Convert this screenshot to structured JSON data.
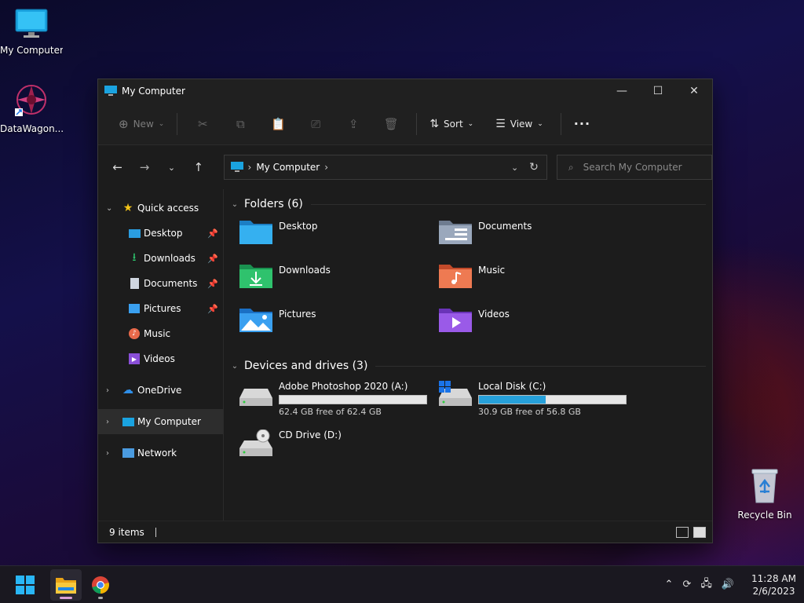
{
  "desktop": {
    "icons": [
      {
        "label": "My Computer"
      },
      {
        "label": "DataWagon..."
      },
      {
        "label": "Recycle Bin"
      }
    ]
  },
  "window": {
    "title": "My Computer",
    "controls": {
      "minimize": "—",
      "maximize": "☐",
      "close": "✕"
    }
  },
  "toolbar": {
    "new_label": "New",
    "sort_label": "Sort",
    "view_label": "View",
    "more_label": "···"
  },
  "nav": {
    "address_crumb": "My Computer",
    "search_placeholder": "Search My Computer"
  },
  "sidebar": {
    "items": [
      {
        "label": "Quick access"
      },
      {
        "label": "Desktop"
      },
      {
        "label": "Downloads"
      },
      {
        "label": "Documents"
      },
      {
        "label": "Pictures"
      },
      {
        "label": "Music"
      },
      {
        "label": "Videos"
      },
      {
        "label": "OneDrive"
      },
      {
        "label": "My Computer"
      },
      {
        "label": "Network"
      }
    ]
  },
  "content": {
    "folders_header": "Folders (6)",
    "folders": [
      {
        "label": "Desktop"
      },
      {
        "label": "Documents"
      },
      {
        "label": "Downloads"
      },
      {
        "label": "Music"
      },
      {
        "label": "Pictures"
      },
      {
        "label": "Videos"
      }
    ],
    "drives_header": "Devices and drives (3)",
    "drives": [
      {
        "name": "Adobe Photoshop 2020 (A:)",
        "free": "62.4 GB free of 62.4 GB",
        "used_fraction": 0.0
      },
      {
        "name": "Local Disk (C:)",
        "free": "30.9 GB free of 56.8 GB",
        "used_fraction": 0.456
      },
      {
        "name": "CD Drive (D:)"
      }
    ]
  },
  "status": {
    "items_count": "9 items"
  },
  "taskbar": {
    "time": "11:28 AM",
    "date": "2/6/2023"
  },
  "colors": {
    "accent": "#26a0da",
    "window_bg": "#1c1c1c"
  }
}
